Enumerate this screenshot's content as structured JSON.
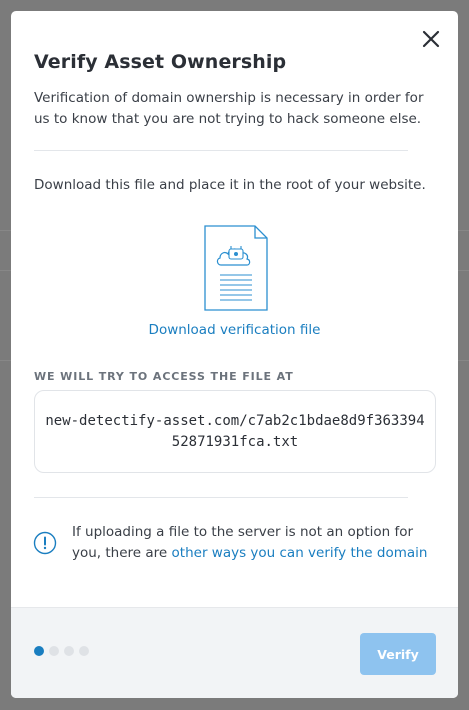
{
  "modal": {
    "title": "Verify Asset Ownership",
    "intro": "Verification of domain ownership is necessary in order for us to know that you are not trying to hack someone else.",
    "instruction": "Download this file and place it in the root of your website.",
    "download_link": "Download verification file",
    "access_label": "WE WILL TRY TO ACCESS THE FILE AT",
    "file_url": "new-detectify-asset.com/c7ab2c1bdae8d9f36339452871931fca.txt",
    "info_text_prefix": "If uploading a file to the server is not an option for you, there are ",
    "info_link": "other ways you can verify the domain",
    "verify_label": "Verify",
    "steps": {
      "total": 4,
      "current": 1
    }
  },
  "colors": {
    "accent": "#1a7ec0",
    "verify_button": "#8ec3ef",
    "footer_bg": "#f2f4f6"
  },
  "icons": {
    "close": "close-icon",
    "file": "file-document-icon",
    "info": "info-icon"
  }
}
